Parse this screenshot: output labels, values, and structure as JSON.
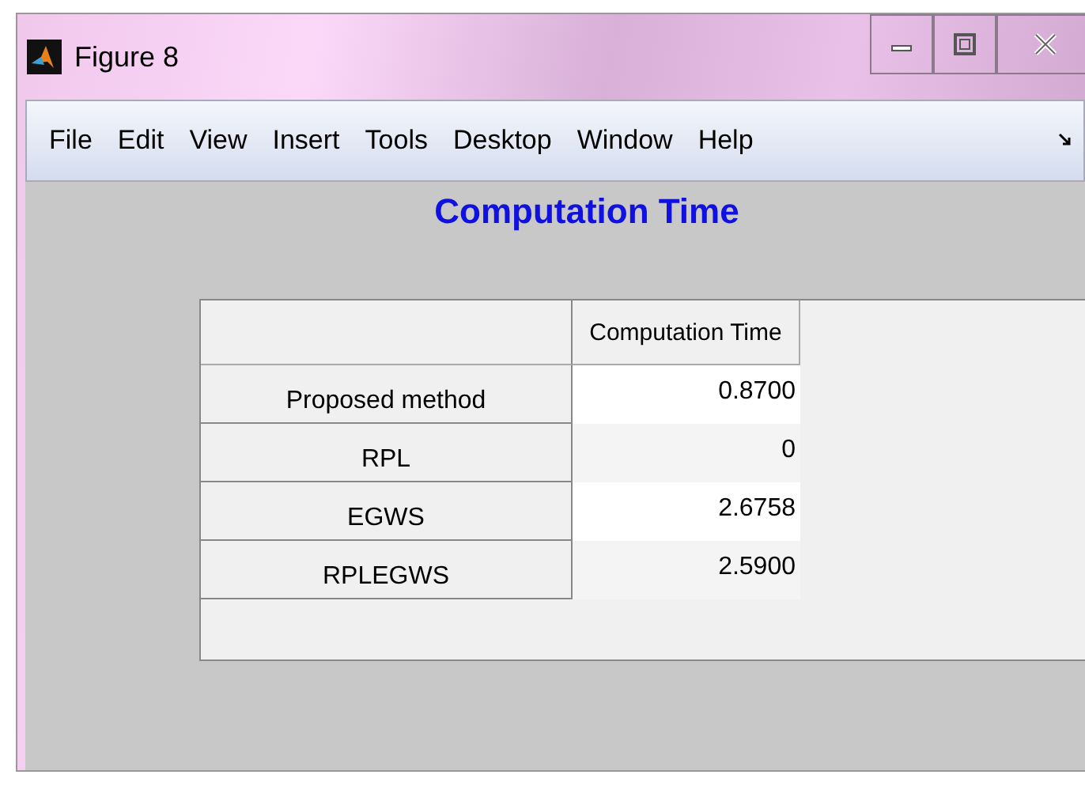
{
  "window": {
    "title": "Figure 8"
  },
  "menu": [
    "File",
    "Edit",
    "View",
    "Insert",
    "Tools",
    "Desktop",
    "Window",
    "Help"
  ],
  "figure_title": "Computation Time",
  "table": {
    "columns": [
      "Computation Time"
    ],
    "rows": [
      {
        "label": "Proposed method",
        "value": "0.8700"
      },
      {
        "label": "RPL",
        "value": "0"
      },
      {
        "label": "EGWS",
        "value": "2.6758"
      },
      {
        "label": "RPLEGWS",
        "value": "2.5900"
      }
    ]
  }
}
